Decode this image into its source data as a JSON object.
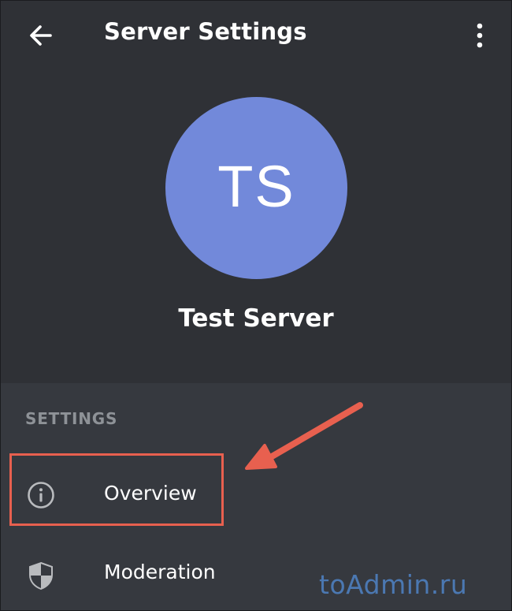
{
  "app_bar": {
    "title": "Server Settings",
    "back_icon": "arrow-left-icon",
    "more_icon": "more-vertical-icon"
  },
  "server": {
    "initials": "TS",
    "name": "Test Server",
    "avatar_color": "#7289da"
  },
  "settings": {
    "header": "SETTINGS",
    "items": [
      {
        "label": "Overview",
        "icon": "info-circle-icon"
      },
      {
        "label": "Moderation",
        "icon": "shield-icon"
      }
    ]
  },
  "annotation": {
    "color": "#e8604f"
  },
  "watermark": {
    "text": "toAdmin.ru"
  },
  "colors": {
    "header_bg": "#2f3136",
    "list_bg": "#36393f",
    "text": "#ffffff",
    "muted": "#8e9297"
  }
}
